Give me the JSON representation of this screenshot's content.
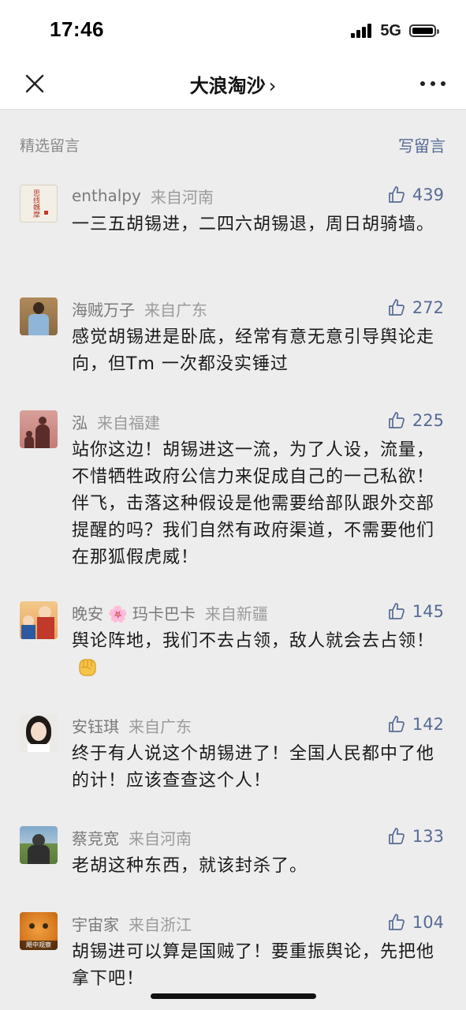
{
  "status_bar": {
    "time": "17:46",
    "network": "5G"
  },
  "nav": {
    "title": "大浪淘沙",
    "chevron": "›"
  },
  "section": {
    "title": "精选留言",
    "write_label": "写留言"
  },
  "comments": [
    {
      "name": "enthalpy",
      "location": "来自河南",
      "likes": "439",
      "text": "一三五胡锡进，二四六胡锡退，周日胡骑墙。",
      "avatar_text": "思线魏摩"
    },
    {
      "name": "海贼万子",
      "location": "来自广东",
      "likes": "272",
      "text": "感觉胡锡进是卧底，经常有意无意引导舆论走向，但Tm 一次都没实锤过"
    },
    {
      "name": "泓",
      "location": "来自福建",
      "likes": "225",
      "text": "站你这边！胡锡进这一流，为了人设，流量，不惜牺牲政府公信力来促成自己的一己私欲！伴飞，击落这种假设是他需要给部队跟外交部提醒的吗？我们自然有政府渠道，不需要他们在那狐假虎威！"
    },
    {
      "name_part1": "晚安",
      "name_emoji": "🌸",
      "name_part2": "玛卡巴卡",
      "location": "来自新疆",
      "likes": "145",
      "text": "舆论阵地，我们不去占领，敌人就会去占领！"
    },
    {
      "name": "安钰琪",
      "location": "来自广东",
      "likes": "142",
      "text": "终于有人说这个胡锡进了！全国人民都中了他的计！应该查查这个人！"
    },
    {
      "name": "蔡竞宽",
      "location": "来自河南",
      "likes": "133",
      "text": "老胡这种东西，就该封杀了。"
    },
    {
      "name": "宇宙家",
      "location": "来自浙江",
      "likes": "104",
      "text": "胡锡进可以算是国贼了！要重振舆论，先把他拿下吧！",
      "avatar_text": "飓中观察"
    }
  ],
  "colors": {
    "accent": "#576b95",
    "background": "#ededed"
  },
  "icons": [
    "close-icon",
    "chevron-right-icon",
    "more-icon",
    "thumbs-up-icon",
    "signal-icon",
    "battery-icon",
    "fist-emoji"
  ]
}
